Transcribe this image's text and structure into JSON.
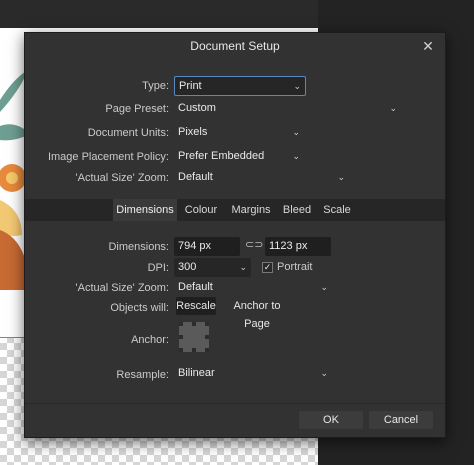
{
  "dialog": {
    "title": "Document Setup",
    "close_icon": "close-icon"
  },
  "general": {
    "type": {
      "label": "Type:",
      "value": "Print"
    },
    "page_preset": {
      "label": "Page Preset:",
      "value": "Custom"
    },
    "document_units": {
      "label": "Document Units:",
      "value": "Pixels"
    },
    "image_placement": {
      "label": "Image Placement Policy:",
      "value": "Prefer Embedded"
    },
    "actual_size_zoom": {
      "label": "'Actual Size' Zoom:",
      "value": "Default"
    }
  },
  "tabs": [
    {
      "label": "Dimensions",
      "active": true
    },
    {
      "label": "Colour",
      "active": false
    },
    {
      "label": "Margins",
      "active": false
    },
    {
      "label": "Bleed",
      "active": false
    },
    {
      "label": "Scale",
      "active": false
    }
  ],
  "dimensions": {
    "dimensions_label": "Dimensions:",
    "width": "794 px",
    "height": "1123 px",
    "dpi_label": "DPI:",
    "dpi": "300",
    "portrait_label": "Portrait",
    "portrait_checked": true,
    "zoom_label": "'Actual Size' Zoom:",
    "zoom_value": "Default",
    "objects_label": "Objects will:",
    "rescale": "Rescale",
    "anchor_to_page": "Anchor to Page",
    "anchor_label": "Anchor:",
    "resample_label": "Resample:",
    "resample_value": "Bilinear"
  },
  "footer": {
    "ok": "OK",
    "cancel": "Cancel"
  },
  "colors": {
    "dialog_bg": "#323232",
    "field_bg": "#1f1f1f",
    "focus_border": "#5a86c2"
  }
}
